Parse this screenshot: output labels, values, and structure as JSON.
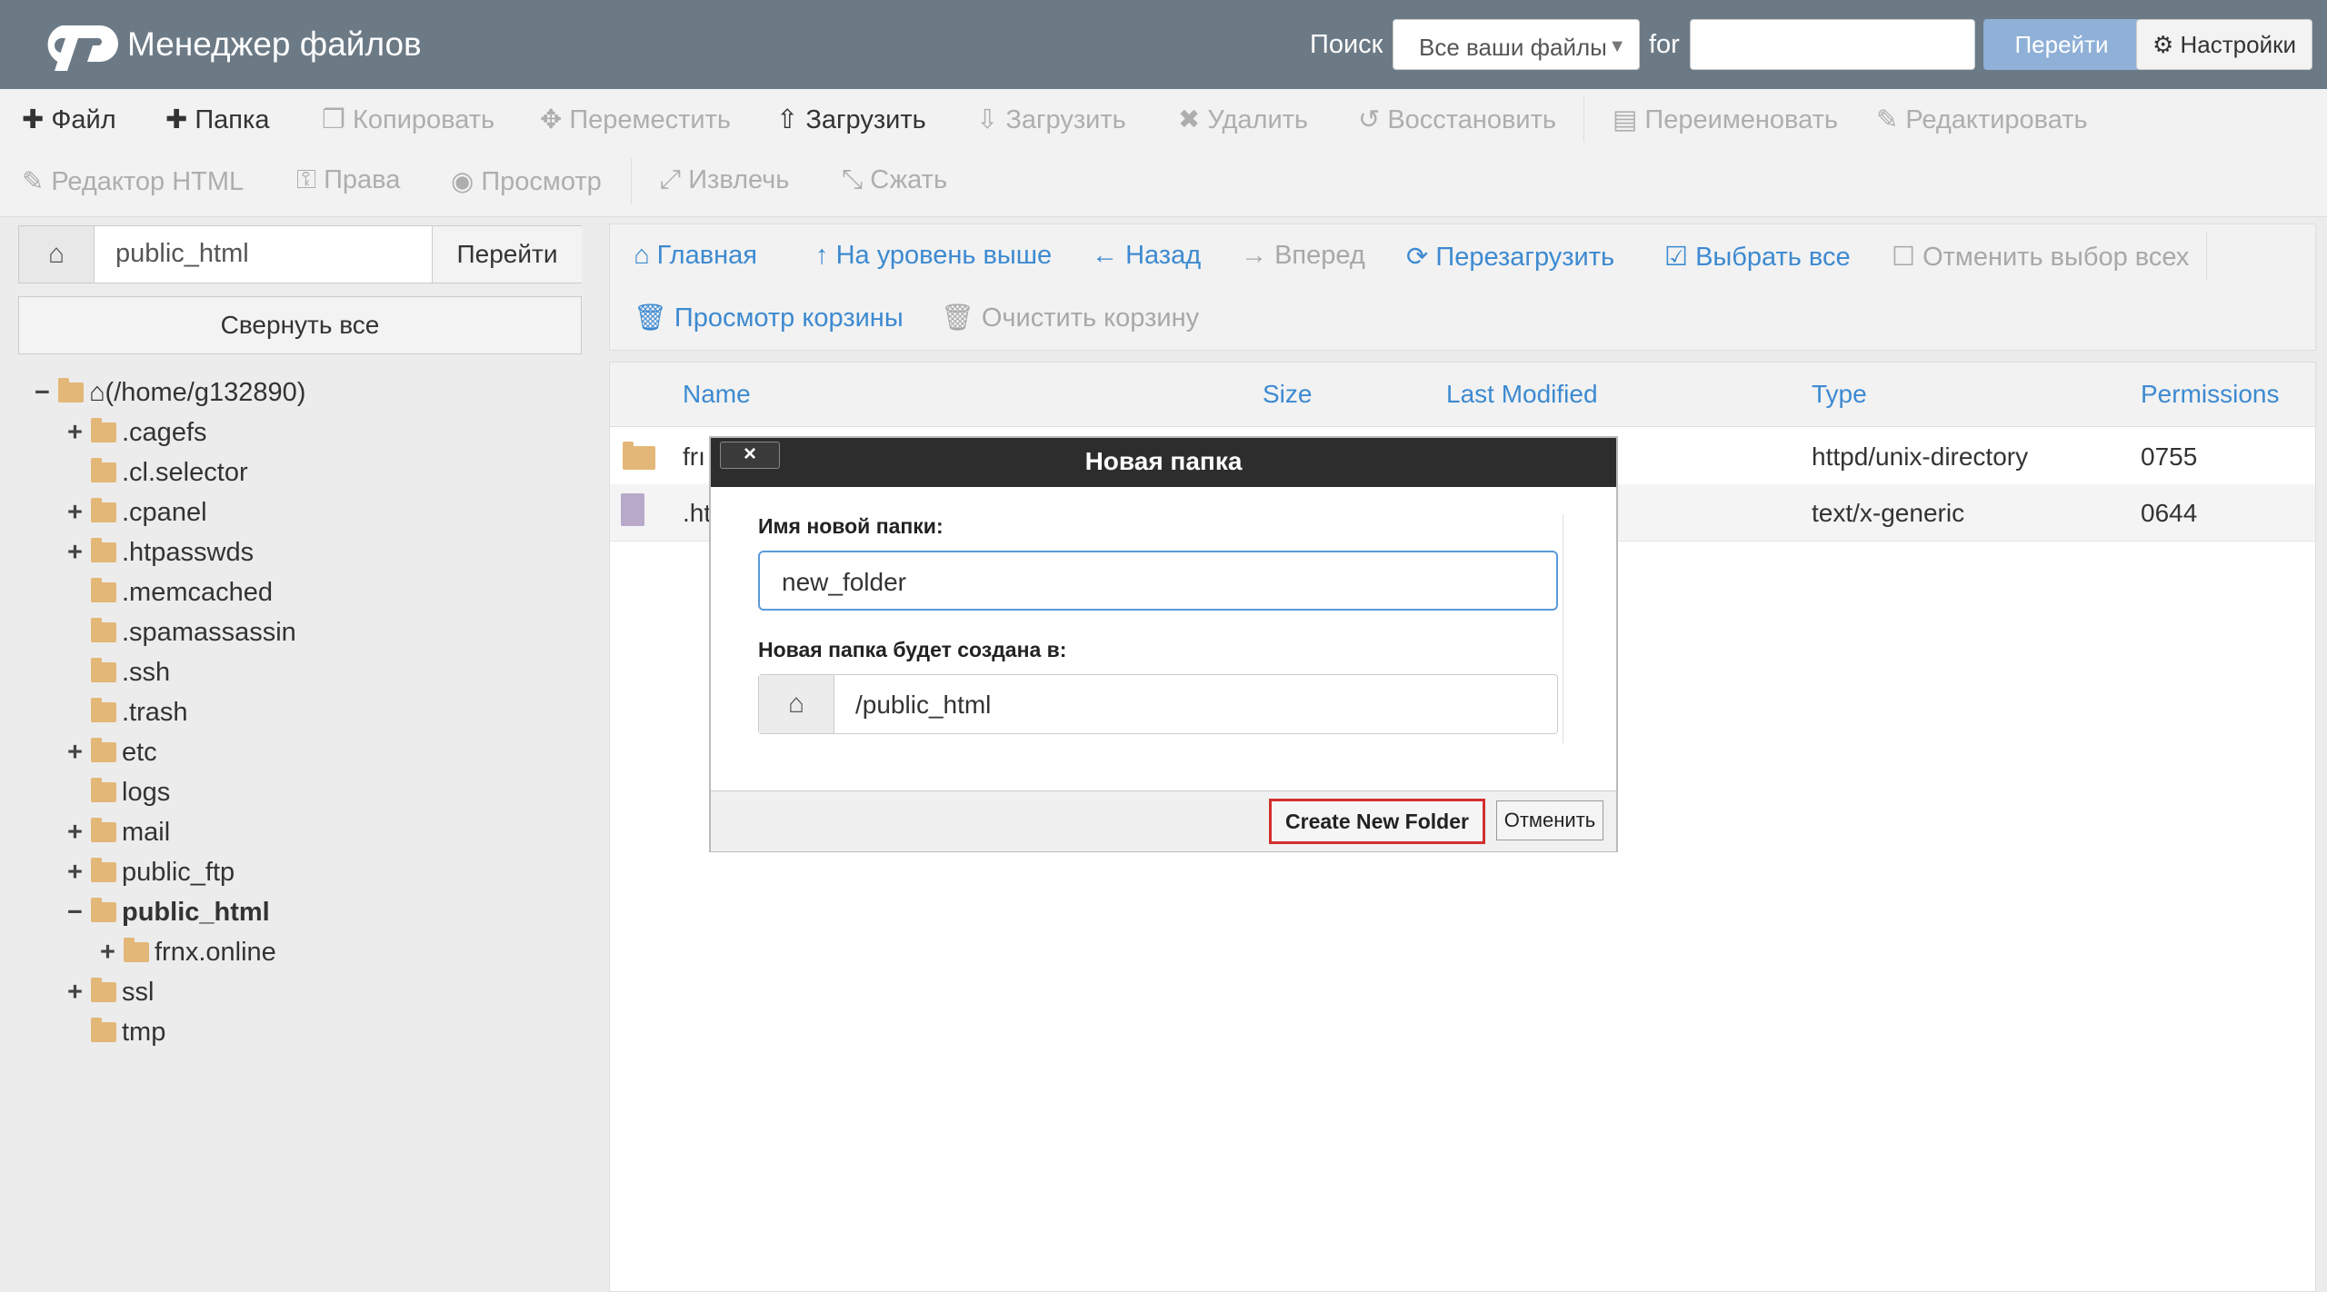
{
  "header": {
    "app_title": "Менеджер файлов",
    "search_label": "Поиск",
    "search_scope": "Все ваши файлы",
    "for_label": "for",
    "search_value": "",
    "go_label": "Перейти",
    "settings_label": "Настройки"
  },
  "toolbar": {
    "file": "Файл",
    "folder": "Папка",
    "copy": "Копировать",
    "move": "Переместить",
    "upload": "Загрузить",
    "download": "Загрузить",
    "delete": "Удалить",
    "restore": "Восстановить",
    "rename": "Переименовать",
    "edit": "Редактировать",
    "html_editor": "Редактор HTML",
    "permissions": "Права",
    "view": "Просмотр",
    "extract": "Извлечь",
    "compress": "Сжать"
  },
  "left": {
    "path_value": "public_html",
    "go_label": "Перейти",
    "collapse_label": "Свернуть все",
    "tree": [
      {
        "toggle": "−",
        "label": "(/home/g132890)"
      },
      {
        "toggle": "+",
        "label": ".cagefs"
      },
      {
        "toggle": "",
        "label": ".cl.selector"
      },
      {
        "toggle": "+",
        "label": ".cpanel"
      },
      {
        "toggle": "+",
        "label": ".htpasswds"
      },
      {
        "toggle": "",
        "label": ".memcached"
      },
      {
        "toggle": "",
        "label": ".spamassassin"
      },
      {
        "toggle": "",
        "label": ".ssh"
      },
      {
        "toggle": "",
        "label": ".trash"
      },
      {
        "toggle": "+",
        "label": "etc"
      },
      {
        "toggle": "",
        "label": "logs"
      },
      {
        "toggle": "+",
        "label": "mail"
      },
      {
        "toggle": "+",
        "label": "public_ftp"
      },
      {
        "toggle": "−",
        "label": "public_html"
      },
      {
        "toggle": "+",
        "label": "frnx.online"
      },
      {
        "toggle": "+",
        "label": "ssl"
      },
      {
        "toggle": "",
        "label": "tmp"
      }
    ]
  },
  "nav": {
    "home": "Главная",
    "up": "На уровень выше",
    "back": "Назад",
    "forward": "Вперед",
    "reload": "Перезагрузить",
    "select_all": "Выбрать все",
    "deselect_all": "Отменить выбор всех",
    "view_trash": "Просмотр корзины",
    "empty_trash": "Очистить корзину"
  },
  "table": {
    "headers": [
      "Name",
      "Size",
      "Last Modified",
      "Type",
      "Permissions"
    ],
    "rows": [
      {
        "name": "frı",
        "type": "httpd/unix-directory",
        "perms": "0755"
      },
      {
        "name": ".ht",
        "type": "text/x-generic",
        "perms": "0644"
      }
    ]
  },
  "dialog": {
    "title": "Новая папка",
    "close": "×",
    "name_label": "Имя новой папки:",
    "name_value": "new_folder",
    "dest_label": "Новая папка будет создана в:",
    "dest_value": "/public_html",
    "create_label": "Create New Folder",
    "cancel_label": "Отменить"
  },
  "colors": {
    "header_bg": "#6c7a86",
    "link_blue": "#3d8ad1",
    "folder": "#e3b777",
    "highlight": "#d32f2f"
  }
}
